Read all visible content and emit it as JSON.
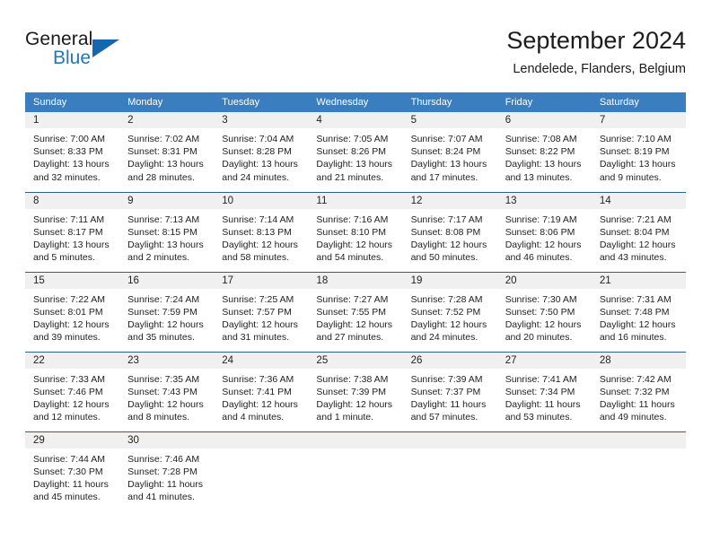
{
  "brand": {
    "word1": "General",
    "word2": "Blue",
    "logo_icon": "triangle-logo-icon",
    "accent_color": "#1566ad"
  },
  "header": {
    "title": "September 2024",
    "subtitle": "Lendelede, Flanders, Belgium"
  },
  "calendar": {
    "header_bg": "#3a7ec0",
    "row_divider_color": "#2a6099",
    "daynum_band_color": "#f0f0f0",
    "weekday_headers": [
      "Sunday",
      "Monday",
      "Tuesday",
      "Wednesday",
      "Thursday",
      "Friday",
      "Saturday"
    ],
    "weeks": [
      [
        {
          "day": "1",
          "sunrise": "Sunrise: 7:00 AM",
          "sunset": "Sunset: 8:33 PM",
          "daylight_line1": "Daylight: 13 hours",
          "daylight_line2": "and 32 minutes."
        },
        {
          "day": "2",
          "sunrise": "Sunrise: 7:02 AM",
          "sunset": "Sunset: 8:31 PM",
          "daylight_line1": "Daylight: 13 hours",
          "daylight_line2": "and 28 minutes."
        },
        {
          "day": "3",
          "sunrise": "Sunrise: 7:04 AM",
          "sunset": "Sunset: 8:28 PM",
          "daylight_line1": "Daylight: 13 hours",
          "daylight_line2": "and 24 minutes."
        },
        {
          "day": "4",
          "sunrise": "Sunrise: 7:05 AM",
          "sunset": "Sunset: 8:26 PM",
          "daylight_line1": "Daylight: 13 hours",
          "daylight_line2": "and 21 minutes."
        },
        {
          "day": "5",
          "sunrise": "Sunrise: 7:07 AM",
          "sunset": "Sunset: 8:24 PM",
          "daylight_line1": "Daylight: 13 hours",
          "daylight_line2": "and 17 minutes."
        },
        {
          "day": "6",
          "sunrise": "Sunrise: 7:08 AM",
          "sunset": "Sunset: 8:22 PM",
          "daylight_line1": "Daylight: 13 hours",
          "daylight_line2": "and 13 minutes."
        },
        {
          "day": "7",
          "sunrise": "Sunrise: 7:10 AM",
          "sunset": "Sunset: 8:19 PM",
          "daylight_line1": "Daylight: 13 hours",
          "daylight_line2": "and 9 minutes."
        }
      ],
      [
        {
          "day": "8",
          "sunrise": "Sunrise: 7:11 AM",
          "sunset": "Sunset: 8:17 PM",
          "daylight_line1": "Daylight: 13 hours",
          "daylight_line2": "and 5 minutes."
        },
        {
          "day": "9",
          "sunrise": "Sunrise: 7:13 AM",
          "sunset": "Sunset: 8:15 PM",
          "daylight_line1": "Daylight: 13 hours",
          "daylight_line2": "and 2 minutes."
        },
        {
          "day": "10",
          "sunrise": "Sunrise: 7:14 AM",
          "sunset": "Sunset: 8:13 PM",
          "daylight_line1": "Daylight: 12 hours",
          "daylight_line2": "and 58 minutes."
        },
        {
          "day": "11",
          "sunrise": "Sunrise: 7:16 AM",
          "sunset": "Sunset: 8:10 PM",
          "daylight_line1": "Daylight: 12 hours",
          "daylight_line2": "and 54 minutes."
        },
        {
          "day": "12",
          "sunrise": "Sunrise: 7:17 AM",
          "sunset": "Sunset: 8:08 PM",
          "daylight_line1": "Daylight: 12 hours",
          "daylight_line2": "and 50 minutes."
        },
        {
          "day": "13",
          "sunrise": "Sunrise: 7:19 AM",
          "sunset": "Sunset: 8:06 PM",
          "daylight_line1": "Daylight: 12 hours",
          "daylight_line2": "and 46 minutes."
        },
        {
          "day": "14",
          "sunrise": "Sunrise: 7:21 AM",
          "sunset": "Sunset: 8:04 PM",
          "daylight_line1": "Daylight: 12 hours",
          "daylight_line2": "and 43 minutes."
        }
      ],
      [
        {
          "day": "15",
          "sunrise": "Sunrise: 7:22 AM",
          "sunset": "Sunset: 8:01 PM",
          "daylight_line1": "Daylight: 12 hours",
          "daylight_line2": "and 39 minutes."
        },
        {
          "day": "16",
          "sunrise": "Sunrise: 7:24 AM",
          "sunset": "Sunset: 7:59 PM",
          "daylight_line1": "Daylight: 12 hours",
          "daylight_line2": "and 35 minutes."
        },
        {
          "day": "17",
          "sunrise": "Sunrise: 7:25 AM",
          "sunset": "Sunset: 7:57 PM",
          "daylight_line1": "Daylight: 12 hours",
          "daylight_line2": "and 31 minutes."
        },
        {
          "day": "18",
          "sunrise": "Sunrise: 7:27 AM",
          "sunset": "Sunset: 7:55 PM",
          "daylight_line1": "Daylight: 12 hours",
          "daylight_line2": "and 27 minutes."
        },
        {
          "day": "19",
          "sunrise": "Sunrise: 7:28 AM",
          "sunset": "Sunset: 7:52 PM",
          "daylight_line1": "Daylight: 12 hours",
          "daylight_line2": "and 24 minutes."
        },
        {
          "day": "20",
          "sunrise": "Sunrise: 7:30 AM",
          "sunset": "Sunset: 7:50 PM",
          "daylight_line1": "Daylight: 12 hours",
          "daylight_line2": "and 20 minutes."
        },
        {
          "day": "21",
          "sunrise": "Sunrise: 7:31 AM",
          "sunset": "Sunset: 7:48 PM",
          "daylight_line1": "Daylight: 12 hours",
          "daylight_line2": "and 16 minutes."
        }
      ],
      [
        {
          "day": "22",
          "sunrise": "Sunrise: 7:33 AM",
          "sunset": "Sunset: 7:46 PM",
          "daylight_line1": "Daylight: 12 hours",
          "daylight_line2": "and 12 minutes."
        },
        {
          "day": "23",
          "sunrise": "Sunrise: 7:35 AM",
          "sunset": "Sunset: 7:43 PM",
          "daylight_line1": "Daylight: 12 hours",
          "daylight_line2": "and 8 minutes."
        },
        {
          "day": "24",
          "sunrise": "Sunrise: 7:36 AM",
          "sunset": "Sunset: 7:41 PM",
          "daylight_line1": "Daylight: 12 hours",
          "daylight_line2": "and 4 minutes."
        },
        {
          "day": "25",
          "sunrise": "Sunrise: 7:38 AM",
          "sunset": "Sunset: 7:39 PM",
          "daylight_line1": "Daylight: 12 hours",
          "daylight_line2": "and 1 minute."
        },
        {
          "day": "26",
          "sunrise": "Sunrise: 7:39 AM",
          "sunset": "Sunset: 7:37 PM",
          "daylight_line1": "Daylight: 11 hours",
          "daylight_line2": "and 57 minutes."
        },
        {
          "day": "27",
          "sunrise": "Sunrise: 7:41 AM",
          "sunset": "Sunset: 7:34 PM",
          "daylight_line1": "Daylight: 11 hours",
          "daylight_line2": "and 53 minutes."
        },
        {
          "day": "28",
          "sunrise": "Sunrise: 7:42 AM",
          "sunset": "Sunset: 7:32 PM",
          "daylight_line1": "Daylight: 11 hours",
          "daylight_line2": "and 49 minutes."
        }
      ],
      [
        {
          "day": "29",
          "sunrise": "Sunrise: 7:44 AM",
          "sunset": "Sunset: 7:30 PM",
          "daylight_line1": "Daylight: 11 hours",
          "daylight_line2": "and 45 minutes."
        },
        {
          "day": "30",
          "sunrise": "Sunrise: 7:46 AM",
          "sunset": "Sunset: 7:28 PM",
          "daylight_line1": "Daylight: 11 hours",
          "daylight_line2": "and 41 minutes."
        },
        {
          "day": "",
          "sunrise": "",
          "sunset": "",
          "daylight_line1": "",
          "daylight_line2": ""
        },
        {
          "day": "",
          "sunrise": "",
          "sunset": "",
          "daylight_line1": "",
          "daylight_line2": ""
        },
        {
          "day": "",
          "sunrise": "",
          "sunset": "",
          "daylight_line1": "",
          "daylight_line2": ""
        },
        {
          "day": "",
          "sunrise": "",
          "sunset": "",
          "daylight_line1": "",
          "daylight_line2": ""
        },
        {
          "day": "",
          "sunrise": "",
          "sunset": "",
          "daylight_line1": "",
          "daylight_line2": ""
        }
      ]
    ]
  }
}
